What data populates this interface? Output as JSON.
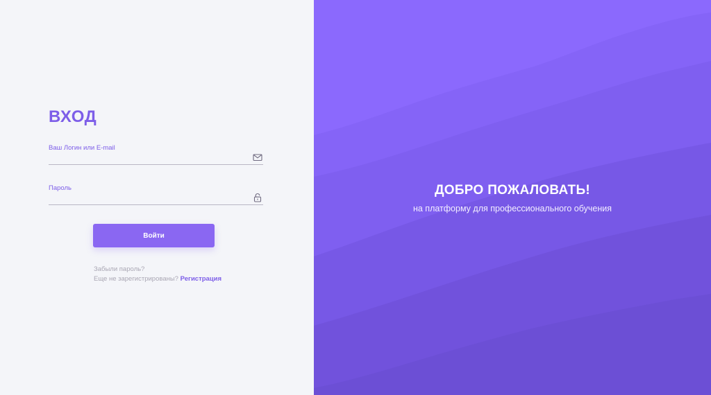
{
  "login": {
    "title": "ВХОД",
    "login_field": {
      "label": "Ваш Логин или E-mail",
      "value": ""
    },
    "password_field": {
      "label": "Пароль",
      "value": ""
    },
    "submit_label": "Войти",
    "forgot_text": "Забыли пароль?",
    "register_prompt": "Еще не зарегистрированы?",
    "register_link": "Регистрация"
  },
  "hero": {
    "title": "ДОБРО ПОЖАЛОВАТЬ!",
    "subtitle": "на платформу для профессионального обучения"
  },
  "icons": {
    "login_field": "envelope-icon",
    "password_field": "lock-icon"
  },
  "colors": {
    "accent": "#7d5ee8",
    "button": "#8a67f2",
    "panel_bg": "#f4f5f9",
    "hero_top": "#8b69fd",
    "hero_bottom": "#6e4fd9"
  }
}
